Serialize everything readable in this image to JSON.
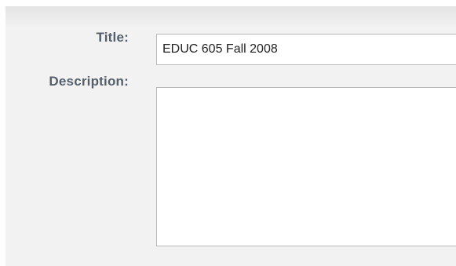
{
  "form": {
    "title_label": "Title:",
    "title_value": "EDUC 605 Fall 2008",
    "description_label": "Description:",
    "description_value": ""
  }
}
